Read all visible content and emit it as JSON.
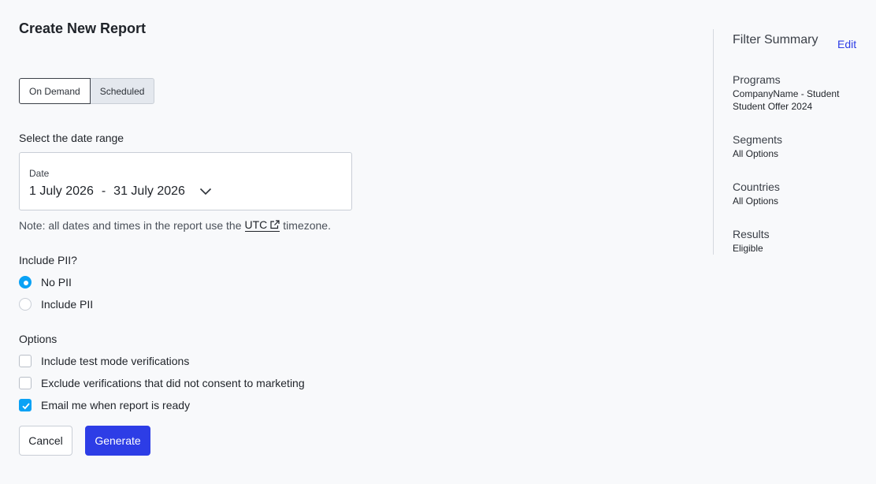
{
  "page": {
    "title": "Create New Report"
  },
  "mode_toggle": {
    "on_demand": "On Demand",
    "scheduled": "Scheduled"
  },
  "date_range": {
    "section_label": "Select the date range",
    "field_label": "Date",
    "start": "1 July 2026",
    "separator": "-",
    "end": "31 July 2026"
  },
  "note": {
    "prefix": "Note: all dates and times in the report use the",
    "link": "UTC",
    "suffix": "timezone."
  },
  "pii": {
    "label": "Include PII?",
    "options": [
      {
        "label": "No PII",
        "selected": true
      },
      {
        "label": "Include PII",
        "selected": false
      }
    ]
  },
  "options": {
    "label": "Options",
    "items": [
      {
        "label": "Include test mode verifications",
        "checked": false
      },
      {
        "label": "Exclude verifications that did not consent to marketing",
        "checked": false
      },
      {
        "label": "Email me when report is ready",
        "checked": true
      }
    ]
  },
  "actions": {
    "cancel": "Cancel",
    "generate": "Generate"
  },
  "filter_summary": {
    "title": "Filter Summary",
    "edit": "Edit",
    "groups": [
      {
        "head": "Programs",
        "lines": [
          "CompanyName - Student",
          "Student Offer 2024"
        ]
      },
      {
        "head": "Segments",
        "lines": [
          "All Options"
        ]
      },
      {
        "head": "Countries",
        "lines": [
          "All Options"
        ]
      },
      {
        "head": "Results",
        "lines": [
          "Eligible"
        ]
      }
    ]
  },
  "colors": {
    "accent": "#2d3de6",
    "check": "#0aa2f5"
  }
}
